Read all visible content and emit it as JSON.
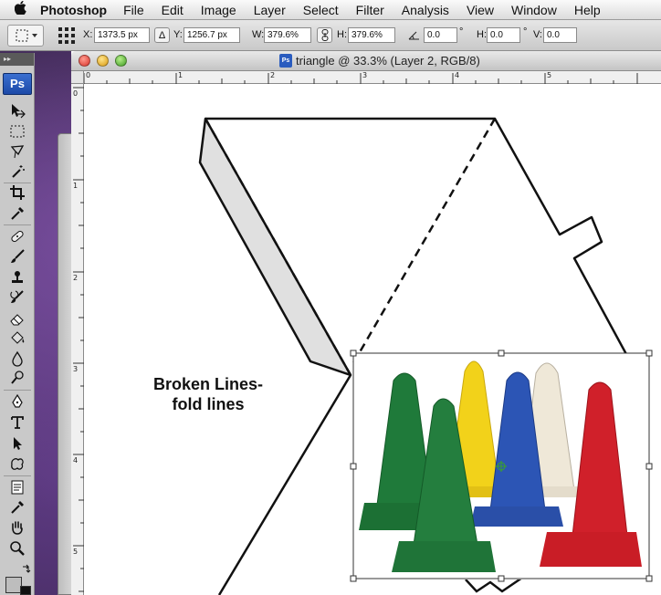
{
  "menubar": {
    "apple": "",
    "app_name": "Photoshop",
    "items": [
      "File",
      "Edit",
      "Image",
      "Layer",
      "Select",
      "Filter",
      "Analysis",
      "View",
      "Window",
      "Help"
    ]
  },
  "options": {
    "x_label": "X:",
    "x_value": "1373.5 px",
    "delta": "Δ",
    "y_label": "Y:",
    "y_value": "1256.7 px",
    "w_label": "W:",
    "w_value": "379.6%",
    "h_label": "H:",
    "h_value": "379.6%",
    "angle_value": "0.0",
    "deg1": "°",
    "hskew_label": "H:",
    "hskew_value": "0.0",
    "deg2": "°",
    "vskew_label": "V:",
    "vskew_value": "0.0"
  },
  "tools": {
    "logo": "Ps",
    "collapse": "▸▸"
  },
  "document": {
    "title": "triangle @ 33.3% (Layer 2, RGB/8)",
    "ps_badge": "Ps"
  },
  "rulers": {
    "h_numbers": [
      "0",
      "1",
      "2",
      "3",
      "4",
      "5"
    ],
    "v_numbers": [
      "0",
      "1",
      "2",
      "3",
      "4",
      "5"
    ]
  },
  "annotation": {
    "line1": "Broken Lines-",
    "line2": "fold lines"
  },
  "colors": {
    "cone_green": "#1f7a3a",
    "cone_yellow": "#f2d21a",
    "cone_blue": "#2c55b5",
    "cone_white": "#efe8d8",
    "cone_red": "#d0202a",
    "panel_shade": "#e0e0e0",
    "ps_blue": "#2a5cbf"
  }
}
